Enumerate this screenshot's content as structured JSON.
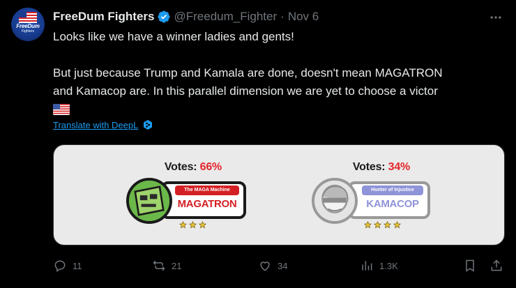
{
  "author": {
    "name": "FreeDum Fighters",
    "handle": "@Freedum_Fighter",
    "separator": "·",
    "date": "Nov 6",
    "avatar_text": "FreeDum",
    "avatar_subtext": "Fighters"
  },
  "tweet": {
    "line1": "Looks like we have a winner ladies and gents!",
    "line2": "But just because Trump and Kamala are done, doesn't mean MAGATRON",
    "line3": "and Kamacop are. In this parallel dimension we are yet to choose a victor",
    "emoji": "flag-us-icon"
  },
  "translate": {
    "label": "Translate with DeepL"
  },
  "media": {
    "left": {
      "votes_label": "Votes:",
      "votes_pct": "66%",
      "subtitle": "The MAGA Machine",
      "name": "MAGATRON",
      "stars": 3,
      "accent": "#d42024"
    },
    "right": {
      "votes_label": "Votes:",
      "votes_pct": "34%",
      "subtitle": "Hunter of Injustice",
      "name": "KAMACOP",
      "stars": 4,
      "accent": "#8f93d8"
    }
  },
  "actions": {
    "replies": "11",
    "reposts": "21",
    "likes": "34",
    "views": "1.3K"
  },
  "colors": {
    "background": "#000000",
    "text": "#e7e9ea",
    "muted": "#71767b",
    "link": "#1d9bf0",
    "verified": "#1d9bf0"
  }
}
